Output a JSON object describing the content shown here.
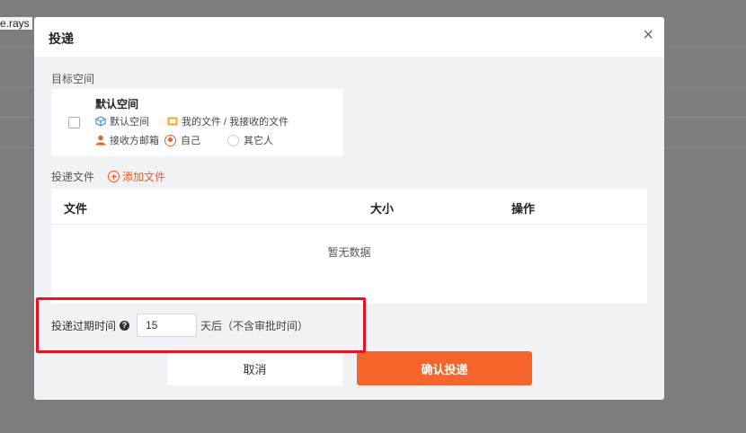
{
  "background": {
    "partial_text": "e.rays"
  },
  "dialog": {
    "title": "投递",
    "close_symbol": "×"
  },
  "target_space": {
    "section_label": "目标空间",
    "space_name": "默认空间",
    "space_type": "默认空间",
    "folder_label": "我的文件 / 我接收的文件",
    "recipient_mailbox_label": "接收方邮箱",
    "options": [
      {
        "label": "自己",
        "selected": true
      },
      {
        "label": "其它人",
        "selected": false
      }
    ],
    "checked": false
  },
  "files": {
    "section_label": "投递文件",
    "add_label": "添加文件",
    "columns": [
      "文件",
      "大小",
      "操作"
    ],
    "rows": [],
    "empty_text": "暂无数据"
  },
  "expiry": {
    "label": "投递过期时间",
    "help_icon": "?",
    "value": "15",
    "suffix": "天后（不含审批时间）"
  },
  "actions": {
    "cancel_label": "取消",
    "confirm_label": "确认投递"
  },
  "colors": {
    "accent": "#f05a22",
    "confirm_bg": "#f5642a",
    "highlight": "#e5141f",
    "cube_icon": "#3b8fe0",
    "folder_icon": "#f5a623",
    "person_icon": "#f05a22"
  }
}
